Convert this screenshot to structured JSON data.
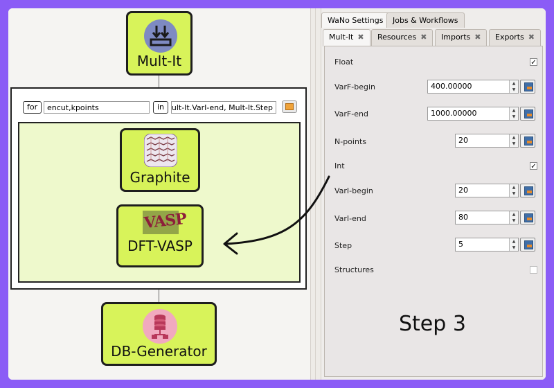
{
  "canvas": {
    "mult_node_label": "Mult-It",
    "loop": {
      "for_keyword": "for",
      "vars_value": "encut,kpoints",
      "in_keyword": "in",
      "expr_value": "ult-It.VarI-end, Mult-It.Step)) )"
    },
    "graphite_label": "Graphite",
    "vasp_label": "DFT-VASP",
    "vasp_logo_text": "VASP",
    "db_label": "DB-Generator"
  },
  "panel": {
    "top_tabs": [
      "WaNo Settings",
      "Jobs & Workflows"
    ],
    "sub_tabs": [
      "Mult-It",
      "Resources",
      "Imports",
      "Exports"
    ],
    "close_glyph": "✖",
    "params": {
      "float_label": "Float",
      "varf_begin_label": "VarF-begin",
      "varf_begin_value": "400.00000",
      "varf_end_label": "VarF-end",
      "varf_end_value": "1000.00000",
      "npoints_label": "N-points",
      "npoints_value": "20",
      "int_label": "Int",
      "vari_begin_label": "VarI-begin",
      "vari_begin_value": "20",
      "vari_end_label": "VarI-end",
      "vari_end_value": "80",
      "step_label": "Step",
      "step_value": "5",
      "structures_label": "Structures"
    },
    "checkmark": "✓"
  },
  "annotation": {
    "step_text": "Step 3"
  },
  "colors": {
    "frame": "#8b5cf6",
    "node": "#d8f35a",
    "inner_loop": "#eef9cc"
  }
}
